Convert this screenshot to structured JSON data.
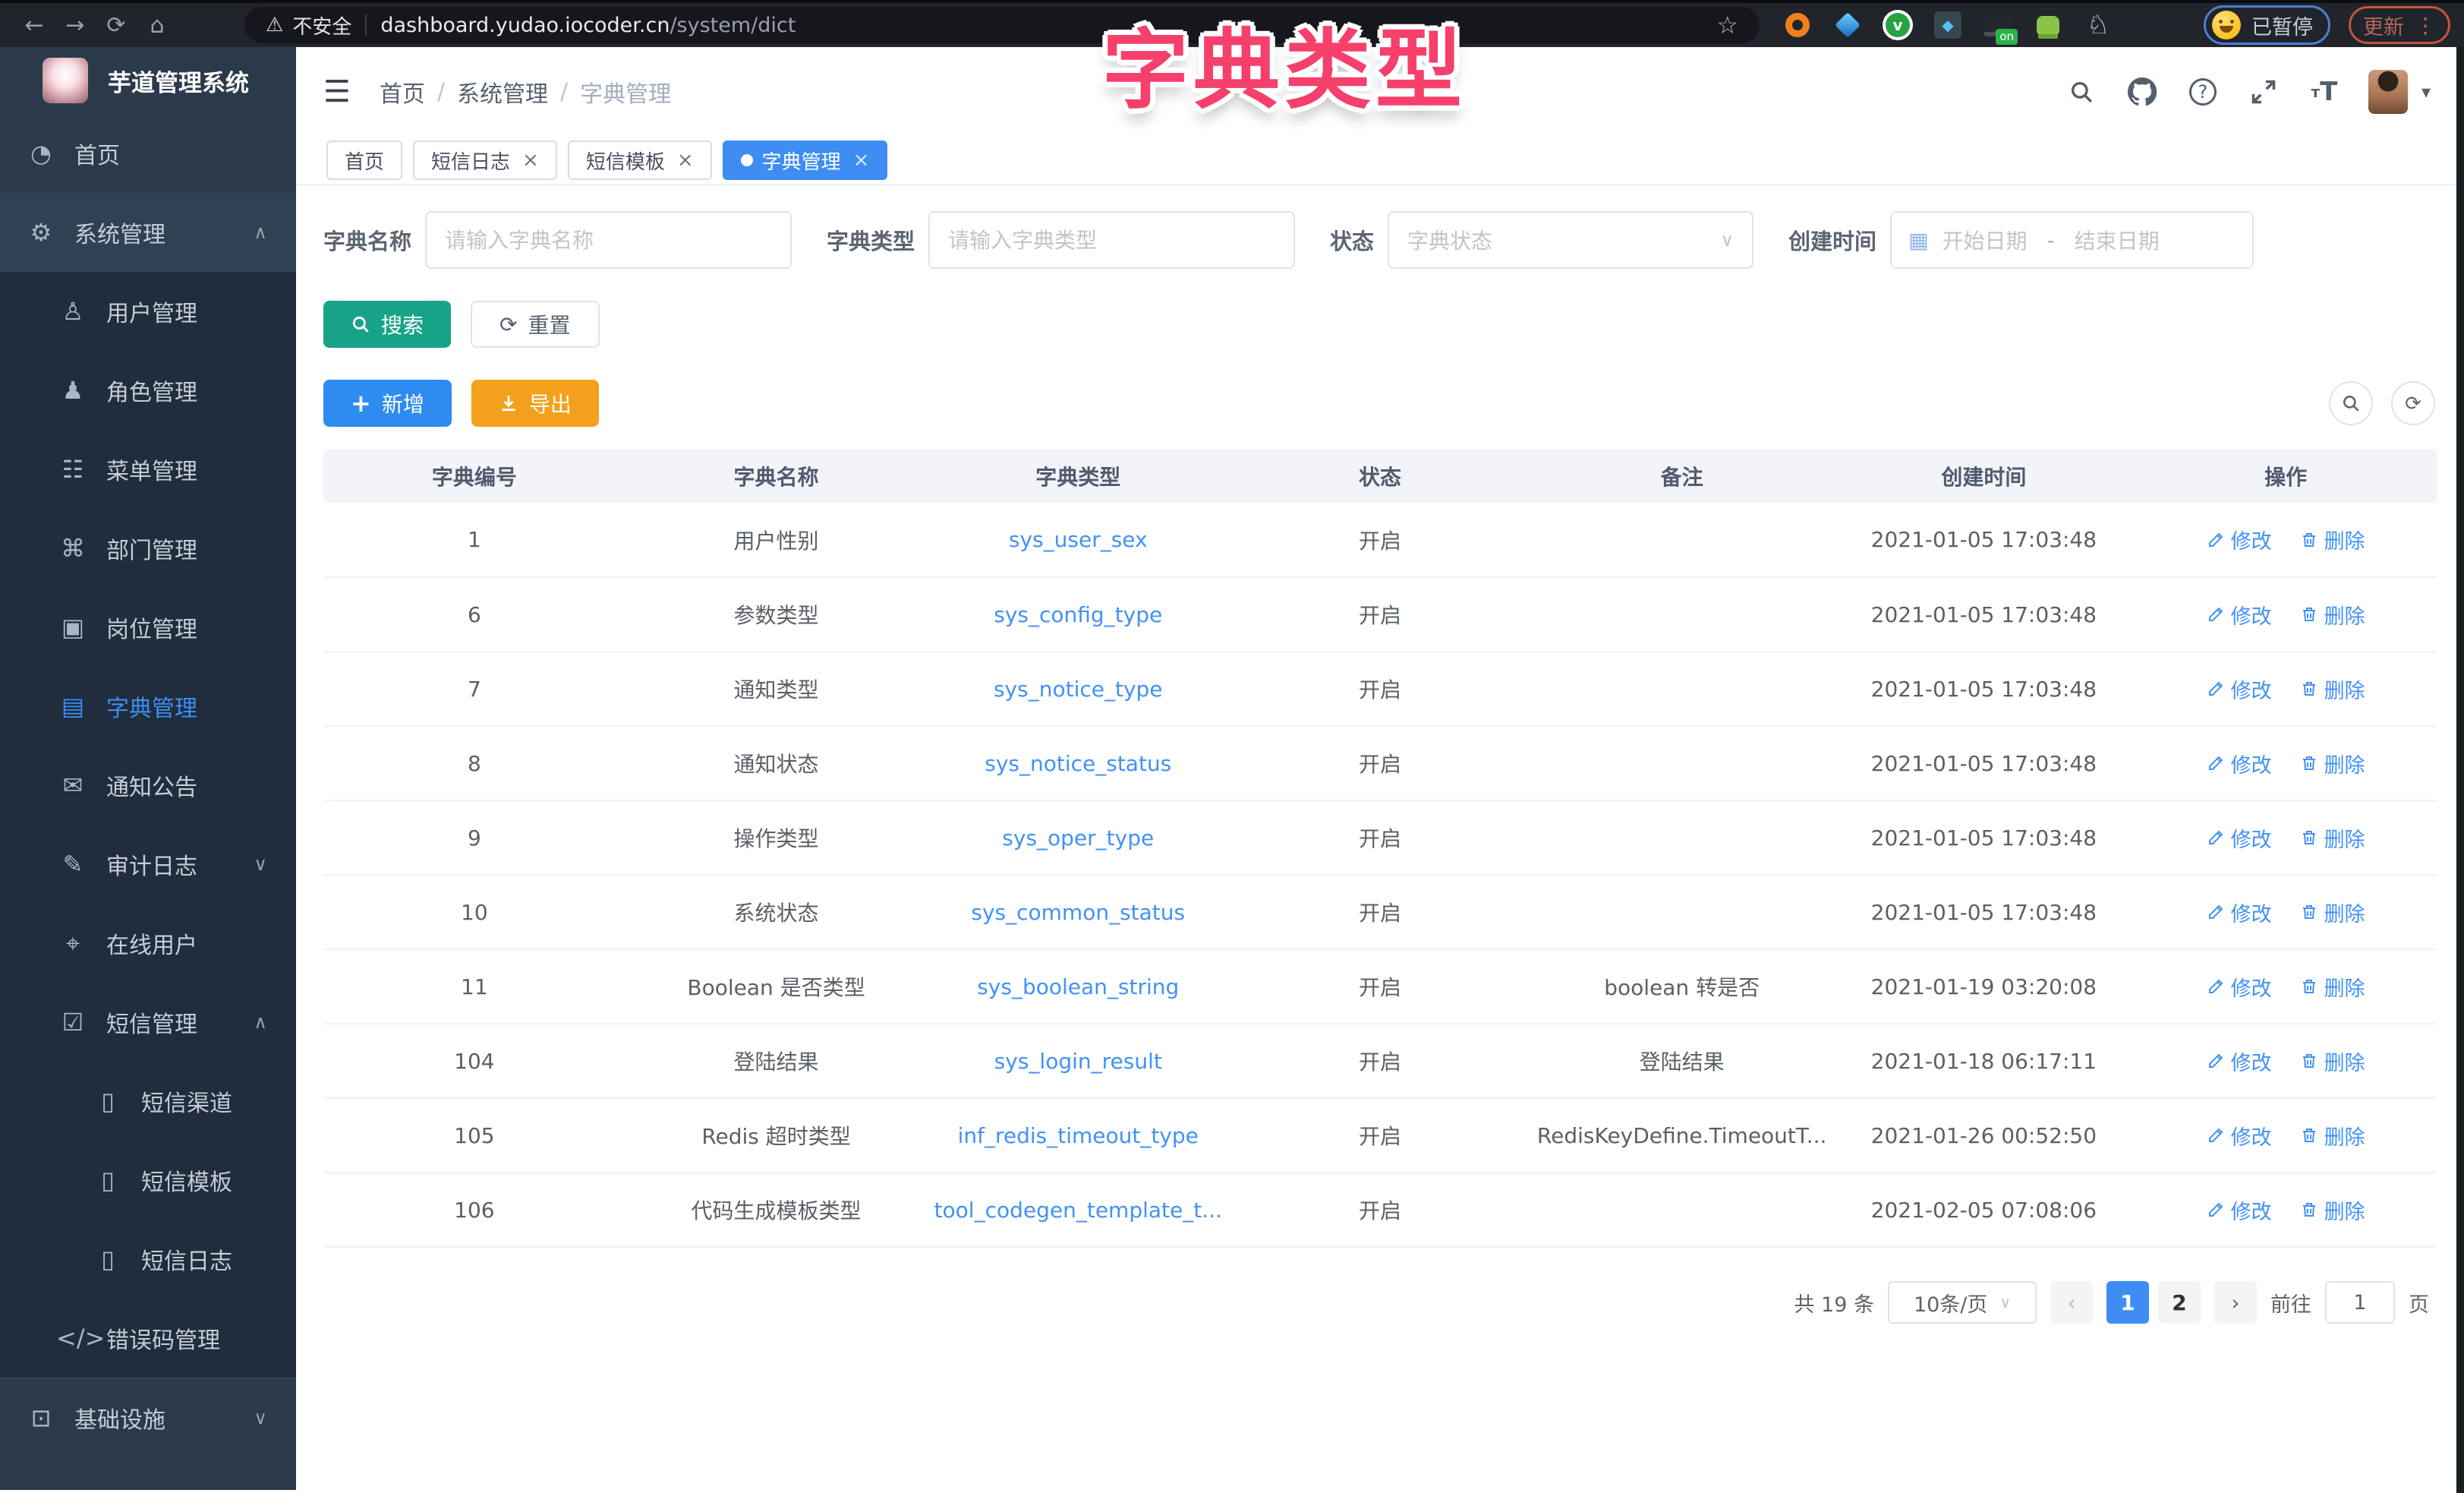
{
  "overlay": {
    "title": "字典类型"
  },
  "browser": {
    "security_label": "不安全",
    "url_host": "dashboard.yudao.iocoder.cn",
    "url_path": "/system/dict",
    "extension_badge_on": "on",
    "paused_label": "已暂停",
    "update_label": "更新"
  },
  "sidebar": {
    "app_title": "芋道管理系统",
    "menu": [
      {
        "label": "首页",
        "icon": "dashboard-icon",
        "level": 0
      },
      {
        "label": "系统管理",
        "icon": "gear-icon",
        "level": 0,
        "chevron": "up",
        "expanded": true
      },
      {
        "label": "用户管理",
        "icon": "user-icon",
        "level": 1
      },
      {
        "label": "角色管理",
        "icon": "users-icon",
        "level": 1
      },
      {
        "label": "菜单管理",
        "icon": "menu-list-icon",
        "level": 1
      },
      {
        "label": "部门管理",
        "icon": "org-icon",
        "level": 1
      },
      {
        "label": "岗位管理",
        "icon": "badge-icon",
        "level": 1
      },
      {
        "label": "字典管理",
        "icon": "dictionary-icon",
        "level": 1,
        "active": true
      },
      {
        "label": "通知公告",
        "icon": "announcement-icon",
        "level": 1
      },
      {
        "label": "审计日志",
        "icon": "audit-icon",
        "level": 1,
        "chevron": "down"
      },
      {
        "label": "在线用户",
        "icon": "online-users-icon",
        "level": 1
      },
      {
        "label": "短信管理",
        "icon": "sms-shield-icon",
        "level": 1,
        "chevron": "up"
      },
      {
        "label": "短信渠道",
        "icon": "phone-icon",
        "level": 2
      },
      {
        "label": "短信模板",
        "icon": "phone-icon",
        "level": 2
      },
      {
        "label": "短信日志",
        "icon": "phone-icon",
        "level": 2
      },
      {
        "label": "错误码管理",
        "icon": "code-icon",
        "level": 1
      },
      {
        "label": "基础设施",
        "icon": "monitor-icon",
        "level": 0,
        "chevron": "down",
        "section_start": true
      }
    ]
  },
  "header": {
    "breadcrumb": [
      "首页",
      "系统管理",
      "字典管理"
    ]
  },
  "tabs": [
    {
      "label": "首页"
    },
    {
      "label": "短信日志",
      "closable": true
    },
    {
      "label": "短信模板",
      "closable": true
    },
    {
      "label": "字典管理",
      "closable": true,
      "active": true
    }
  ],
  "filters": {
    "name_label": "字典名称",
    "name_placeholder": "请输入字典名称",
    "type_label": "字典类型",
    "type_placeholder": "请输入字典类型",
    "status_label": "状态",
    "status_placeholder": "字典状态",
    "created_label": "创建时间",
    "date_start_placeholder": "开始日期",
    "date_separator": "-",
    "date_end_placeholder": "结束日期"
  },
  "actions": {
    "search": "搜索",
    "reset": "重置",
    "add": "新增",
    "export": "导出"
  },
  "table": {
    "columns": [
      "字典编号",
      "字典名称",
      "字典类型",
      "状态",
      "备注",
      "创建时间",
      "操作"
    ],
    "edit_label": "修改",
    "delete_label": "删除",
    "rows": [
      {
        "id": "1",
        "name": "用户性别",
        "type": "sys_user_sex",
        "status": "开启",
        "remark": "",
        "created": "2021-01-05 17:03:48"
      },
      {
        "id": "6",
        "name": "参数类型",
        "type": "sys_config_type",
        "status": "开启",
        "remark": "",
        "created": "2021-01-05 17:03:48"
      },
      {
        "id": "7",
        "name": "通知类型",
        "type": "sys_notice_type",
        "status": "开启",
        "remark": "",
        "created": "2021-01-05 17:03:48"
      },
      {
        "id": "8",
        "name": "通知状态",
        "type": "sys_notice_status",
        "status": "开启",
        "remark": "",
        "created": "2021-01-05 17:03:48"
      },
      {
        "id": "9",
        "name": "操作类型",
        "type": "sys_oper_type",
        "status": "开启",
        "remark": "",
        "created": "2021-01-05 17:03:48"
      },
      {
        "id": "10",
        "name": "系统状态",
        "type": "sys_common_status",
        "status": "开启",
        "remark": "",
        "created": "2021-01-05 17:03:48"
      },
      {
        "id": "11",
        "name": "Boolean 是否类型",
        "type": "sys_boolean_string",
        "status": "开启",
        "remark": "boolean 转是否",
        "created": "2021-01-19 03:20:08"
      },
      {
        "id": "104",
        "name": "登陆结果",
        "type": "sys_login_result",
        "status": "开启",
        "remark": "登陆结果",
        "created": "2021-01-18 06:17:11"
      },
      {
        "id": "105",
        "name": "Redis 超时类型",
        "type": "inf_redis_timeout_type",
        "status": "开启",
        "remark": "RedisKeyDefine.TimeoutT...",
        "created": "2021-01-26 00:52:50"
      },
      {
        "id": "106",
        "name": "代码生成模板类型",
        "type": "tool_codegen_template_t...",
        "status": "开启",
        "remark": "",
        "created": "2021-02-05 07:08:06"
      }
    ]
  },
  "pagination": {
    "total": "共 19 条",
    "page_size": "10条/页",
    "prev": "‹",
    "pages": [
      "1",
      "2"
    ],
    "active_page": "1",
    "next": "›",
    "goto_label": "前往",
    "goto_value": "1",
    "unit_label": "页"
  },
  "colors": {
    "primary": "#3d8df5",
    "search_teal": "#18a389",
    "export_orange": "#f3a11c",
    "link_blue": "#4192f7",
    "overlay_pink": "#f5406b",
    "sidebar_bg": "#2b3a4a",
    "submenu_bg": "#1f2d3c"
  }
}
